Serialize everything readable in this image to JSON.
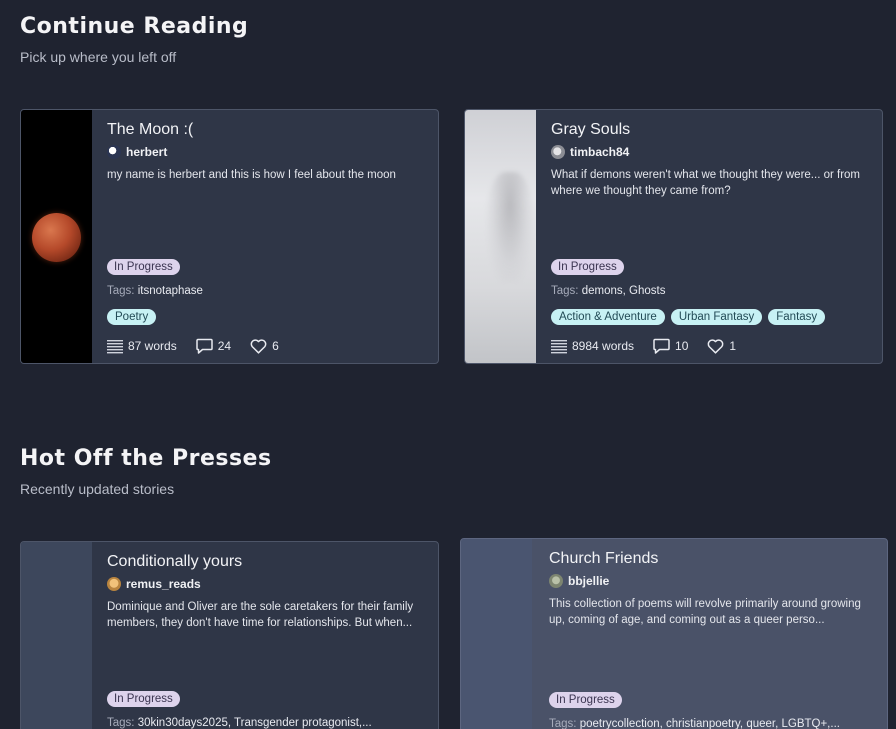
{
  "continue_reading": {
    "title": "Continue Reading",
    "subtitle": "Pick up where you left off",
    "cards": [
      {
        "title": "The Moon :(",
        "author": "herbert",
        "description": "my name is herbert and this is how I feel about the moon",
        "status": "In Progress",
        "tags_label": "Tags:",
        "tags": "itsnotaphase",
        "genres": [
          "Poetry"
        ],
        "words": "87 words",
        "comments": "24",
        "likes": "6"
      },
      {
        "title": "Gray Souls",
        "author": "timbach84",
        "description": "What if demons weren't what we thought they were... or from where we thought they came from?",
        "status": "In Progress",
        "tags_label": "Tags:",
        "tags": "demons, Ghosts",
        "genres": [
          "Action & Adventure",
          "Urban Fantasy",
          "Fantasy"
        ],
        "words": "8984 words",
        "comments": "10",
        "likes": "1"
      }
    ]
  },
  "hot_off_presses": {
    "title": "Hot Off the Presses",
    "subtitle": "Recently updated stories",
    "cards": [
      {
        "title": "Conditionally yours",
        "author": "remus_reads",
        "description": "Dominique and Oliver are the sole caretakers for their family members, they don't have time for relationships. But when...",
        "status": "In Progress",
        "tags_label": "Tags:",
        "tags": "30kin30days2025, Transgender protagonist,..."
      },
      {
        "title": "Church Friends",
        "author": "bbjellie",
        "description": "This collection of poems will revolve primarily around growing up, coming of age, and coming out as a queer perso...",
        "status": "In Progress",
        "tags_label": "Tags:",
        "tags": "poetrycollection, christianpoetry, queer, LGBTQ+,..."
      }
    ]
  },
  "colors": {
    "background": "#1f2330",
    "card": "#2f3647",
    "status_badge": "#ddd3ec",
    "genre_badge": "#c7f1f4"
  },
  "icons": {
    "words": "lines-icon",
    "comments": "comment-icon",
    "likes": "heart-icon"
  }
}
